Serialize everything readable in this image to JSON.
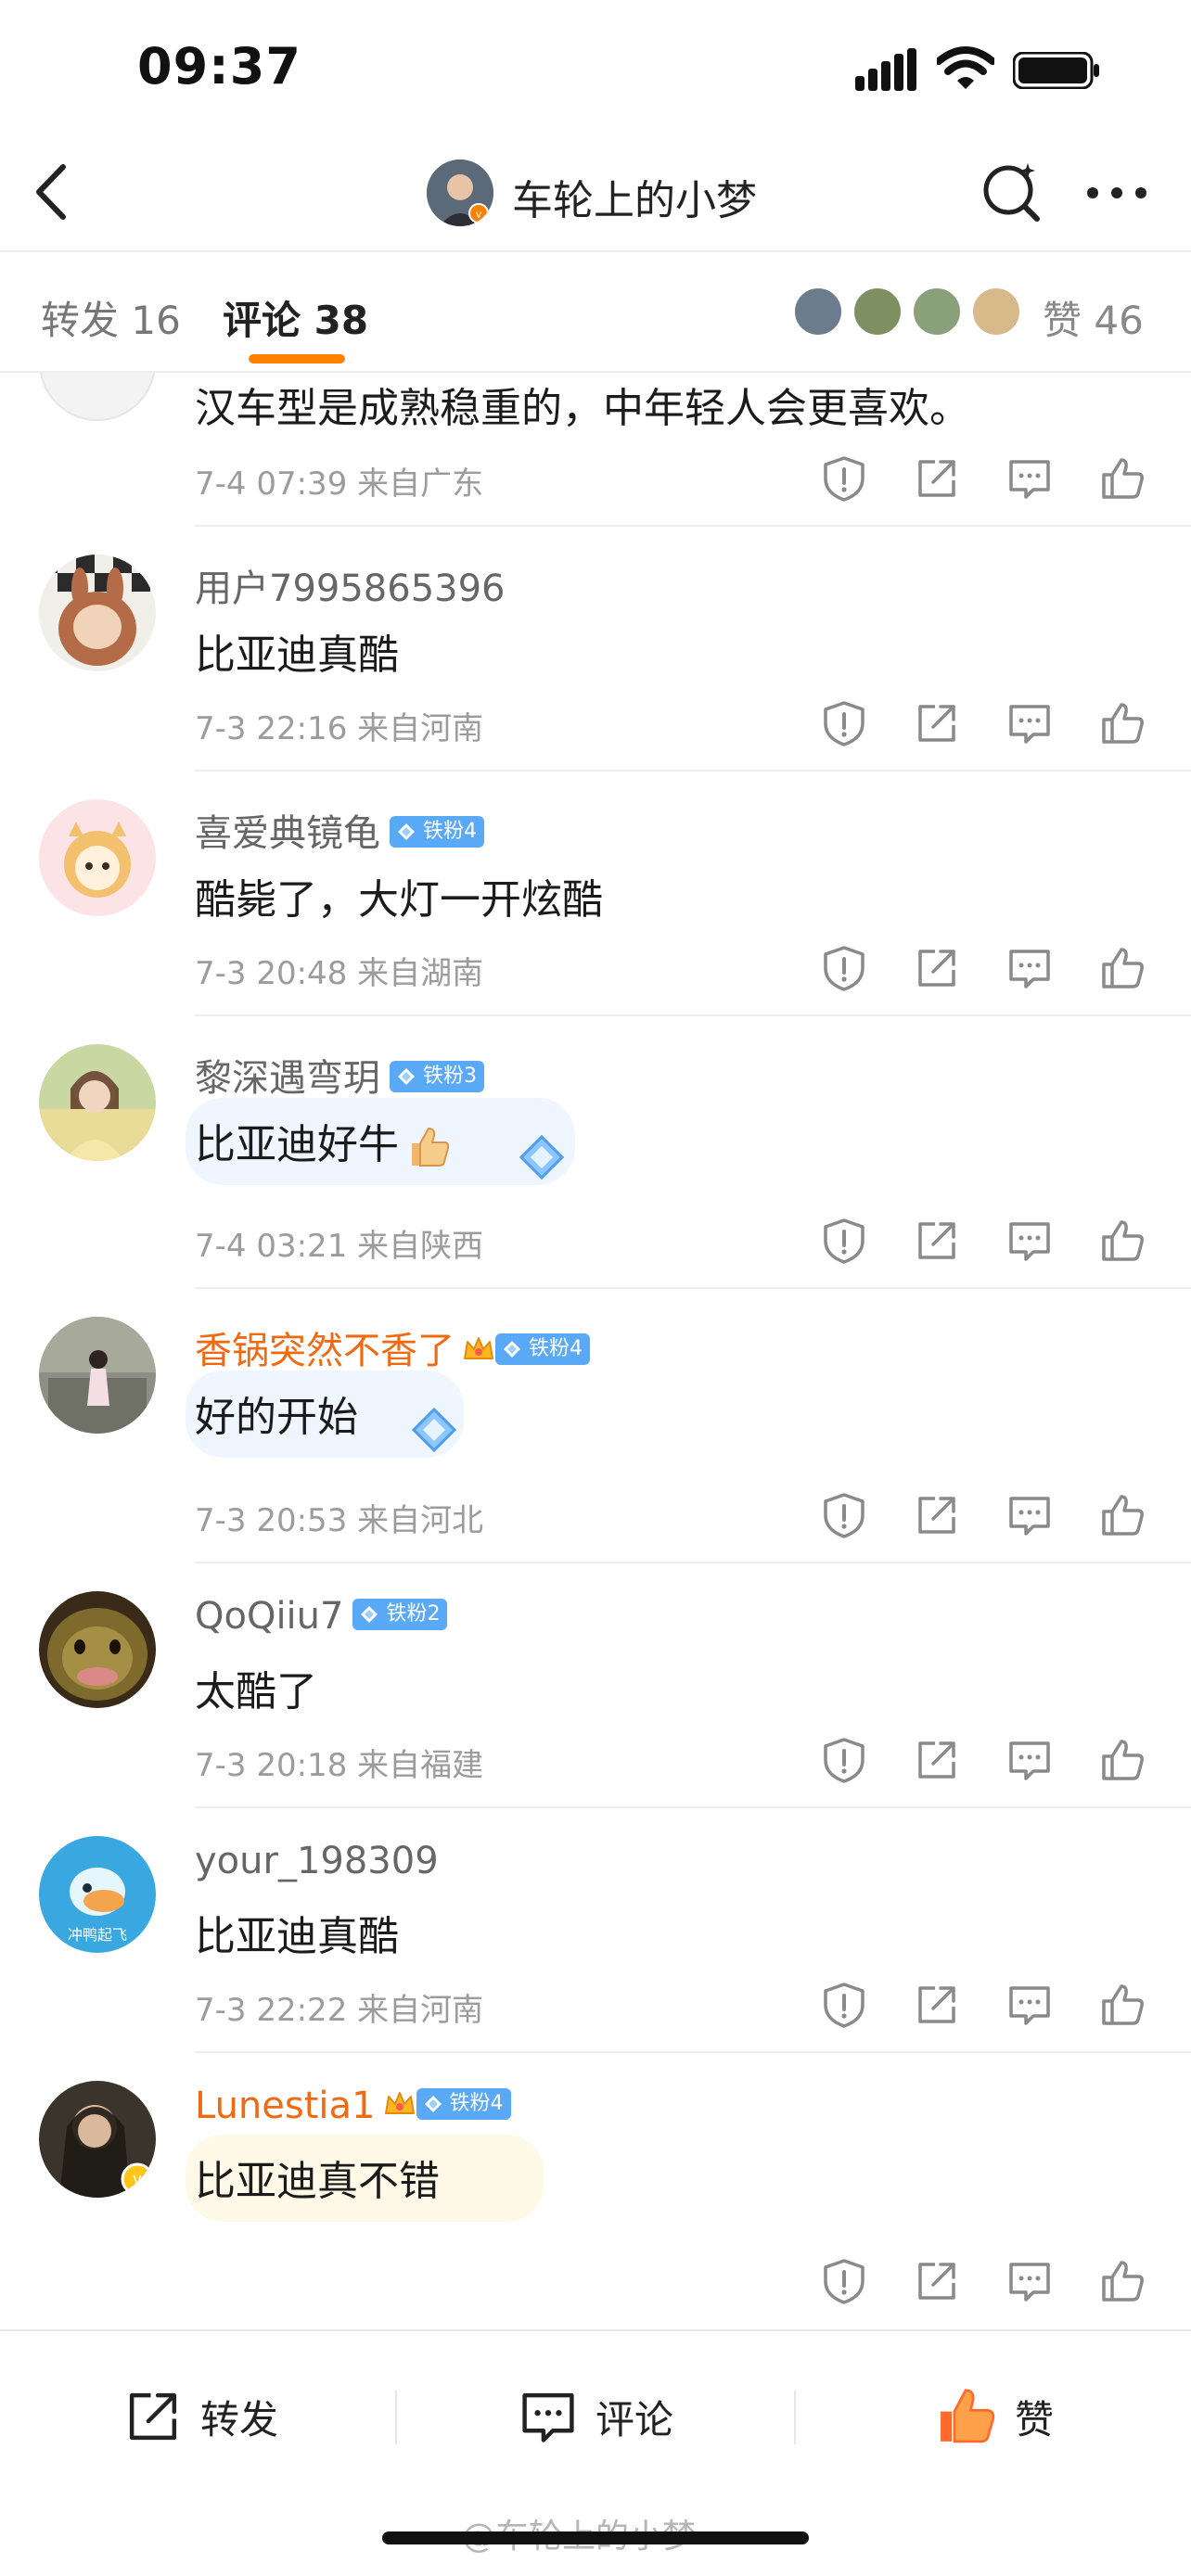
{
  "status_bar": {
    "time": "09:37"
  },
  "nav": {
    "title": "车轮上的小梦"
  },
  "tabs": {
    "repost_label": "转发 16",
    "comment_label": "评论 38",
    "likes_label": "赞 46"
  },
  "comments": [
    {
      "name": "",
      "text": "汉车型是成熟稳重的，中年轻人会更喜欢。",
      "meta": "7-4 07:39  来自广东"
    },
    {
      "name": "用户7995865396",
      "text": "比亚迪真酷",
      "meta": "7-3 22:16  来自河南"
    },
    {
      "name": "喜爱典镜龟",
      "badge": "铁粉4",
      "text": "酷毙了，大灯一开炫酷",
      "meta": "7-3 20:48  来自湖南"
    },
    {
      "name": "黎深遇弯玥",
      "badge": "铁粉3",
      "text": "比亚迪好牛",
      "meta": "7-4 03:21  来自陕西"
    },
    {
      "name": "香锅突然不香了",
      "badge": "铁粉4",
      "text": "好的开始",
      "meta": "7-3 20:53  来自河北"
    },
    {
      "name": "QoQiiu7",
      "badge": "铁粉2",
      "text": "太酷了",
      "meta": "7-3 20:18  来自福建"
    },
    {
      "name": "your_198309",
      "text": "比亚迪真酷",
      "meta": "7-3 22:22  来自河南"
    },
    {
      "name": "Lunestia1",
      "badge": "铁粉4",
      "text": "比亚迪真不错",
      "meta": ""
    }
  ],
  "avatar_texts": {
    "your_198309": "冲鸭起飞"
  },
  "bottom_bar": {
    "repost": "转发",
    "comment": "评论",
    "like": "赞"
  },
  "watermark": "@车轮上的小梦",
  "colors": {
    "accent": "#ff8200",
    "vip_name": "#ee6b14",
    "badge": "#5aa9f6",
    "meta": "#9c9c9c"
  },
  "icons": [
    "back-icon",
    "search-icon",
    "more-icon",
    "report-icon",
    "share-icon",
    "comment-icon",
    "like-icon"
  ]
}
